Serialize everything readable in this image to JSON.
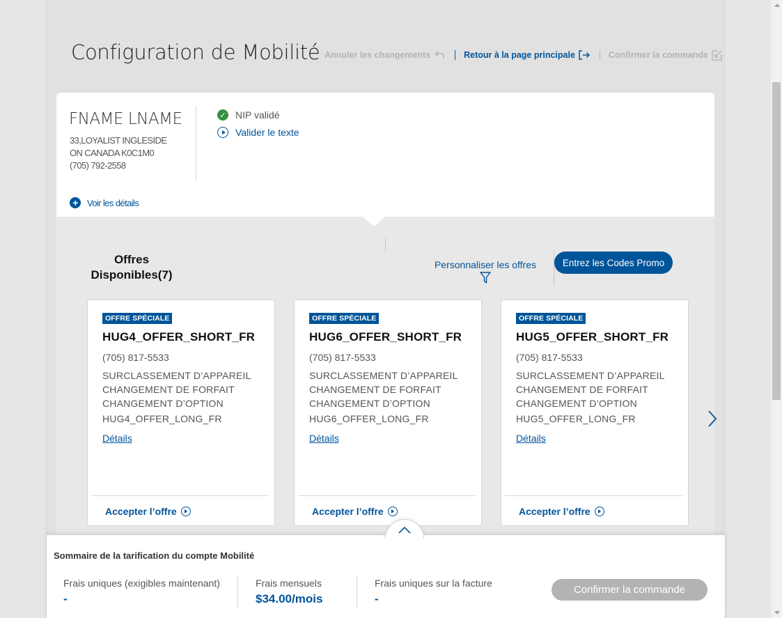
{
  "page": {
    "title": "Configuration de Mobilité"
  },
  "header_actions": {
    "cancel_label": "Annuler les changements",
    "back_label": "Retour à la page principale",
    "confirm_label": "Confirmer la commande"
  },
  "customer": {
    "name": "FNAME LNAME",
    "address_line1": "33,LOYALIST INGLESIDE",
    "address_line2": "ON CANADA K0C1M0",
    "phone": "(705) 792-2558",
    "pin_status": "NIP validé",
    "validate_text": "Valider le texte",
    "details_link": "Voir les détails"
  },
  "offers": {
    "title_line1": "Offres",
    "title_line2": "Disponibles(7)",
    "personalize_label": "Personnaliser les offres",
    "promo_button": "Entrez les Codes Promo",
    "items": [
      {
        "badge": "OFFRE SPÉCIALE",
        "name": "HUG4_OFFER_SHORT_FR",
        "phone": "(705) 817-5533",
        "line1": "SURCLASSEMENT D’APPAREIL",
        "line2": "CHANGEMENT DE FORFAIT",
        "line3": "CHANGEMENT D’OPTION",
        "long": "HUG4_OFFER_LONG_FR",
        "details": "Détails",
        "accept": "Accepter l’offre"
      },
      {
        "badge": "OFFRE SPÉCIALE",
        "name": "HUG6_OFFER_SHORT_FR",
        "phone": "(705) 817-5533",
        "line1": "SURCLASSEMENT D’APPAREIL",
        "line2": "CHANGEMENT DE FORFAIT",
        "line3": "CHANGEMENT D’OPTION",
        "long": "HUG6_OFFER_LONG_FR",
        "details": "Détails",
        "accept": "Accepter l’offre"
      },
      {
        "badge": "OFFRE SPÉCIALE",
        "name": "HUG5_OFFER_SHORT_FR",
        "phone": "(705) 817-5533",
        "line1": "SURCLASSEMENT D’APPAREIL",
        "line2": "CHANGEMENT DE FORFAIT",
        "line3": "CHANGEMENT D’OPTION",
        "long": "HUG5_OFFER_LONG_FR",
        "details": "Détails",
        "accept": "Accepter l’offre"
      }
    ]
  },
  "summary": {
    "title": "Sommaire de la tarification du compte Mobilité",
    "one_time_label": "Frais uniques (exigibles maintenant)",
    "one_time_value": "-",
    "monthly_label": "Frais mensuels",
    "monthly_value": "$34.00/mois",
    "bill_label": "Frais uniques sur la facture",
    "bill_value": "-",
    "confirm_button": "Confirmer la commande"
  },
  "icons": {
    "cancel": "undo-arrow-icon",
    "back": "exit-arrow-icon",
    "confirm": "checkout-arrow-icon",
    "pin": "check-circle-icon",
    "validate": "play-circle-icon",
    "details": "plus-circle-icon",
    "personalize": "funnel-icon",
    "next": "chevron-right-icon",
    "toggle": "chevron-up-icon"
  },
  "colors": {
    "brand_blue": "#00549a",
    "success_green": "#339043",
    "disabled_grey": "#b3b3b3"
  }
}
